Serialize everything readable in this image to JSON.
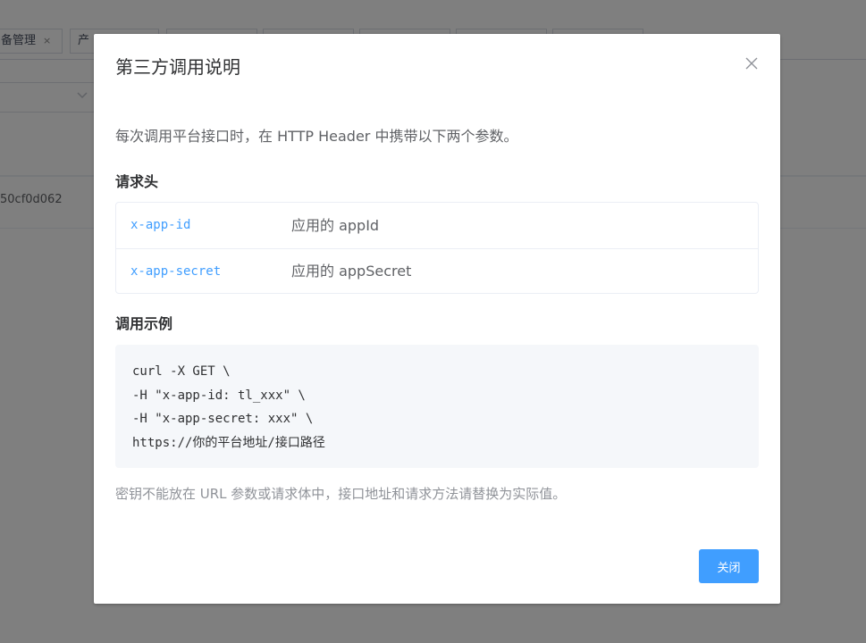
{
  "background": {
    "tabs": [
      {
        "label": "备管理",
        "close": "×"
      },
      {
        "label": "产"
      },
      {
        "label": ""
      },
      {
        "label": ""
      },
      {
        "label": ""
      },
      {
        "label": ""
      },
      {
        "label": ""
      }
    ],
    "row_text": "50cf0d062"
  },
  "dialog": {
    "title": "第三方调用说明",
    "close_icon": "close-icon",
    "intro": "每次调用平台接口时，在 HTTP Header 中携带以下两个参数。",
    "headers_title": "请求头",
    "headers": [
      {
        "key": "x-app-id",
        "desc": "应用的 appId"
      },
      {
        "key": "x-app-secret",
        "desc": "应用的 appSecret"
      }
    ],
    "example_title": "调用示例",
    "code_lines": [
      "curl -X GET \\",
      "-H \"x-app-id: tl_xxx\" \\",
      "-H \"x-app-secret: xxx\" \\",
      "https://你的平台地址/接口路径"
    ],
    "note": "密钥不能放在 URL 参数或请求体中，接口地址和请求方法请替换为实际值。",
    "close_button": "关闭"
  },
  "colors": {
    "accent": "#409eff",
    "overlay": "rgba(0,0,0,0.5)"
  }
}
